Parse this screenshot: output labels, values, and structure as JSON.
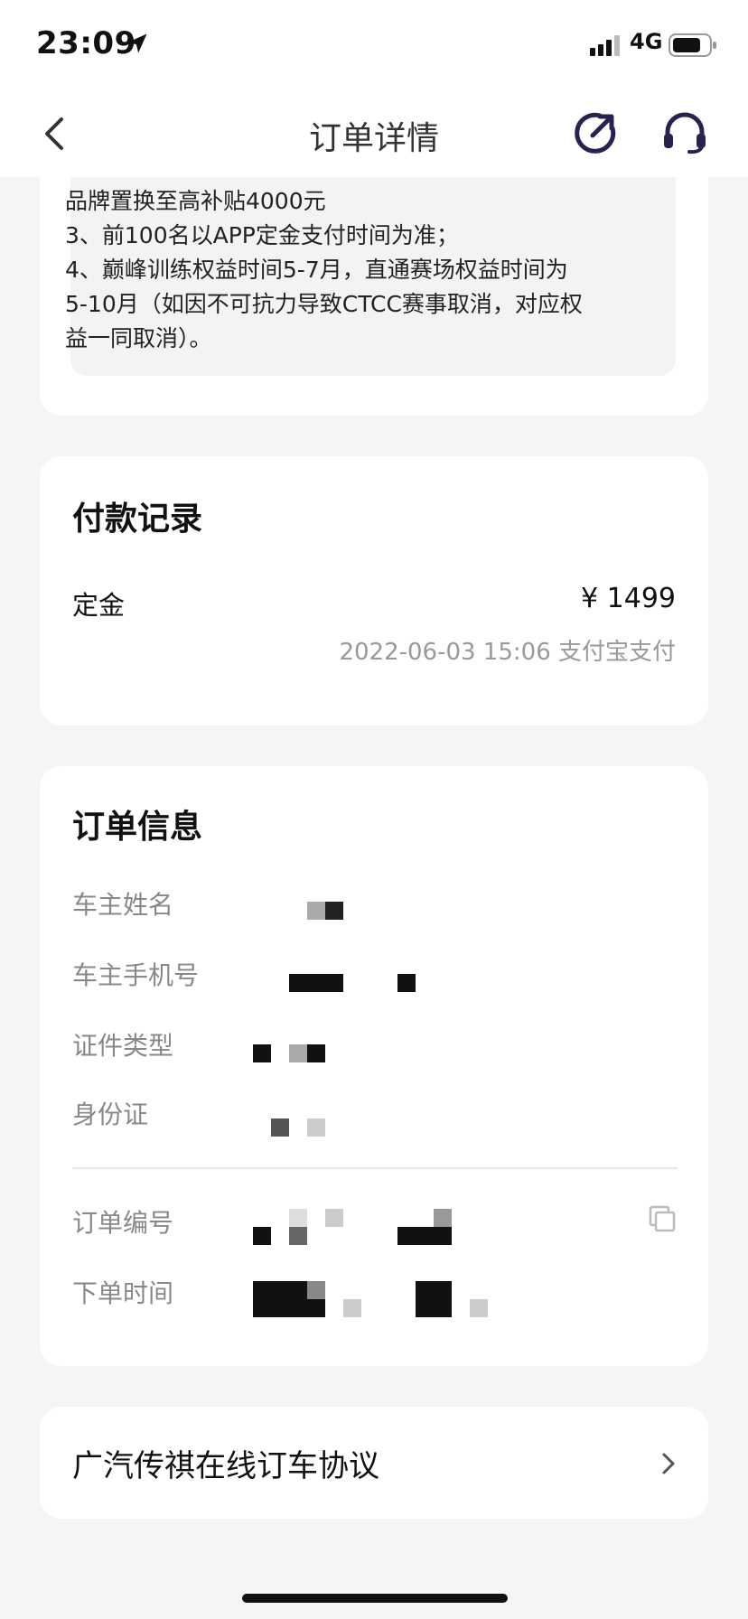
{
  "status_bar": {
    "time": "23:09",
    "network": "4G"
  },
  "nav": {
    "title": "订单详情",
    "back_icon": "chevron-left-icon",
    "share_icon": "share-icon",
    "service_icon": "headset-icon",
    "accent_color": "#2b2150"
  },
  "notes": {
    "lines": [
      "品牌置换至高补贴4000元",
      "3、前100名以APP定金支付时间为准；",
      "4、巅峰训练权益时间5-7月，直通赛场权益时间为",
      "5-10月（如因不可抗力导致CTCC赛事取消，对应权",
      "益一同取消）。"
    ]
  },
  "payment": {
    "title": "付款记录",
    "deposit_label": "定金",
    "deposit_amount": "¥ 1499",
    "meta": "2022-06-03 15:06 支付宝支付"
  },
  "order_info": {
    "title": "订单信息",
    "rows": [
      {
        "label": "车主姓名"
      },
      {
        "label": "车主手机号"
      },
      {
        "label": "证件类型"
      },
      {
        "label": "身份证"
      },
      {
        "label": "订单编号"
      },
      {
        "label": "下单时间"
      }
    ]
  },
  "agreement": {
    "label": "广汽传祺在线订车协议"
  }
}
